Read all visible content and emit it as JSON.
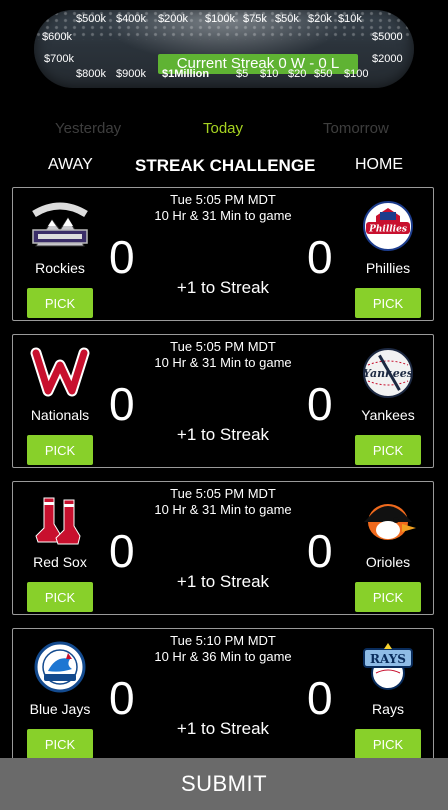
{
  "ladder": {
    "row1": [
      "$500k",
      "$400k",
      "$200k",
      "$100k",
      "$75k",
      "$50k",
      "$20k",
      "$10k"
    ],
    "left_top": "$600k",
    "left_bottom": "$700k",
    "right_top": "$5000",
    "right_bottom": "$2000",
    "row3": [
      "$800k",
      "$900k",
      "$1Million",
      "$5",
      "$10",
      "$20",
      "$50",
      "$100"
    ],
    "streak_label": "Current Streak 0 W - 0 L",
    "accent": "#5fb333"
  },
  "tabs": {
    "yesterday": "Yesterday",
    "today": "Today",
    "tomorrow": "Tomorrow",
    "active_color": "#a6d321"
  },
  "header": {
    "away": "AWAY",
    "title": "STREAK CHALLENGE",
    "home": "HOME"
  },
  "games": [
    {
      "time": "Tue 5:05 PM MDT",
      "countdown": "10 Hr & 31 Min to game",
      "away": {
        "name": "Rockies",
        "score": "0",
        "logo": "rockies-logo",
        "pick": "PICK"
      },
      "home": {
        "name": "Phillies",
        "score": "0",
        "logo": "phillies-logo",
        "pick": "PICK"
      },
      "bonus": "+1 to Streak"
    },
    {
      "time": "Tue 5:05 PM MDT",
      "countdown": "10 Hr & 31 Min to game",
      "away": {
        "name": "Nationals",
        "score": "0",
        "logo": "nationals-logo",
        "pick": "PICK"
      },
      "home": {
        "name": "Yankees",
        "score": "0",
        "logo": "yankees-logo",
        "pick": "PICK"
      },
      "bonus": "+1 to Streak"
    },
    {
      "time": "Tue 5:05 PM MDT",
      "countdown": "10 Hr & 31 Min to game",
      "away": {
        "name": "Red Sox",
        "score": "0",
        "logo": "red-sox-logo",
        "pick": "PICK"
      },
      "home": {
        "name": "Orioles",
        "score": "0",
        "logo": "orioles-logo",
        "pick": "PICK"
      },
      "bonus": "+1 to Streak"
    },
    {
      "time": "Tue 5:10 PM MDT",
      "countdown": "10 Hr & 36 Min to game",
      "away": {
        "name": "Blue Jays",
        "score": "0",
        "logo": "blue-jays-logo",
        "pick": "PICK"
      },
      "home": {
        "name": "Rays",
        "score": "0",
        "logo": "rays-logo",
        "pick": "PICK"
      },
      "bonus": "+1 to Streak"
    }
  ],
  "submit_label": "SUBMIT",
  "pick_color": "#88d02a"
}
